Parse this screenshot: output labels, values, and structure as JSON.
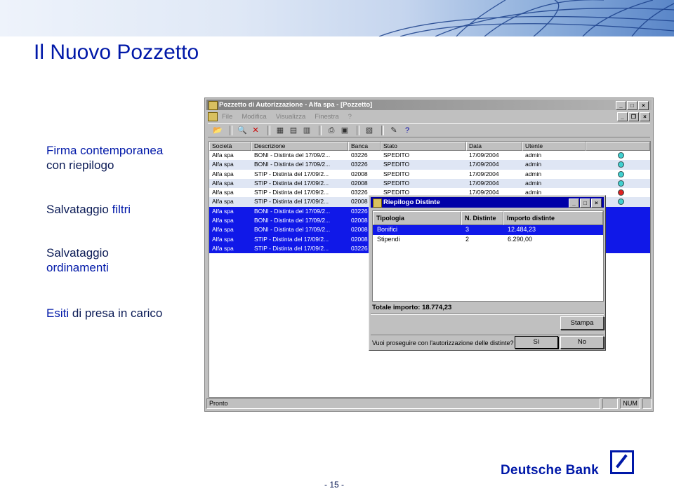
{
  "slide": {
    "title": "Il Nuovo Pozzetto",
    "bullets": [
      {
        "line1": "Firma contemporanea",
        "line2": "con riepilogo"
      },
      {
        "text_a": "Salvataggio",
        "text_b": "filtri"
      },
      {
        "line1": "Salvataggio",
        "line2": "ordinamenti"
      },
      {
        "text_a": "Esiti",
        "text_b": "di presa in carico"
      }
    ],
    "page_number": "- 15 -",
    "logo_text": "Deutsche Bank"
  },
  "window": {
    "title": "Pozzetto di Autorizzazione - Alfa spa - [Pozzetto]",
    "menu": [
      "File",
      "Modifica",
      "Visualizza",
      "Finestra",
      "?"
    ],
    "toolbar_icons": [
      "open-icon",
      "search-icon",
      "delete-icon",
      "filter-icon",
      "filter-sort-icon",
      "calendar-icon",
      "print-icon",
      "print-preview-icon",
      "document-icon",
      "sign-icon",
      "help-icon"
    ],
    "columns": [
      "Società",
      "Descrizione",
      "Banca",
      "Stato",
      "Data",
      "Utente"
    ],
    "rows": [
      {
        "societa": "Alfa spa",
        "descrizione": "BONI - Distinta del 17/09/2...",
        "banca": "03226",
        "stato": "SPEDITO",
        "data": "17/09/2004",
        "utente": "admin",
        "status_color": "#40d0d0",
        "state": "normal"
      },
      {
        "societa": "Alfa spa",
        "descrizione": "BONI - Distinta del 17/09/2...",
        "banca": "03226",
        "stato": "SPEDITO",
        "data": "17/09/2004",
        "utente": "admin",
        "status_color": "#40d0d0",
        "state": "alt"
      },
      {
        "societa": "Alfa spa",
        "descrizione": "STIP - Distinta del 17/09/2...",
        "banca": "02008",
        "stato": "SPEDITO",
        "data": "17/09/2004",
        "utente": "admin",
        "status_color": "#40d0d0",
        "state": "normal"
      },
      {
        "societa": "Alfa spa",
        "descrizione": "STIP - Distinta del 17/09/2...",
        "banca": "02008",
        "stato": "SPEDITO",
        "data": "17/09/2004",
        "utente": "admin",
        "status_color": "#40d0d0",
        "state": "alt"
      },
      {
        "societa": "Alfa spa",
        "descrizione": "STIP - Distinta del 17/09/2...",
        "banca": "03226",
        "stato": "SPEDITO",
        "data": "17/09/2004",
        "utente": "admin",
        "status_color": "#e02020",
        "state": "normal"
      },
      {
        "societa": "Alfa spa",
        "descrizione": "STIP - Distinta del 17/09/2...",
        "banca": "02008",
        "stato": "",
        "data": "",
        "utente": "",
        "status_color": "#40d0d0",
        "state": "alt"
      },
      {
        "societa": "Alfa spa",
        "descrizione": "BONI - Distinta del 17/09/2...",
        "banca": "03226",
        "stato": "",
        "data": "",
        "utente": "",
        "status_color": "",
        "state": "sel"
      },
      {
        "societa": "Alfa spa",
        "descrizione": "BONI - Distinta del 17/09/2...",
        "banca": "02008",
        "stato": "",
        "data": "",
        "utente": "",
        "status_color": "",
        "state": "sel"
      },
      {
        "societa": "Alfa spa",
        "descrizione": "BONI - Distinta del 17/09/2...",
        "banca": "02008",
        "stato": "",
        "data": "",
        "utente": "",
        "status_color": "",
        "state": "sel"
      },
      {
        "societa": "Alfa spa",
        "descrizione": "STIP - Distinta del 17/09/2...",
        "banca": "02008",
        "stato": "",
        "data": "",
        "utente": "",
        "status_color": "",
        "state": "sel"
      },
      {
        "societa": "Alfa spa",
        "descrizione": "STIP - Distinta del 17/09/2...",
        "banca": "03226",
        "stato": "",
        "data": "",
        "utente": "",
        "status_color": "",
        "state": "sel"
      }
    ],
    "status_bar": {
      "left": "Pronto",
      "num": "NUM"
    }
  },
  "dialog": {
    "title": "Riepilogo Distinte",
    "columns": [
      "Tipologia",
      "N. Distinte",
      "Importo distinte"
    ],
    "rows": [
      {
        "tipologia": "Bonifici",
        "n": "3",
        "importo": "12.484,23",
        "selected": true
      },
      {
        "tipologia": "Stipendi",
        "n": "2",
        "importo": "6.290,00",
        "selected": false
      }
    ],
    "total": "Totale importo: 18.774,23",
    "print_button": "Stampa",
    "question": "Vuoi proseguire con l'autorizzazione delle distinte?",
    "yes_button": "Sì",
    "no_button": "No"
  }
}
